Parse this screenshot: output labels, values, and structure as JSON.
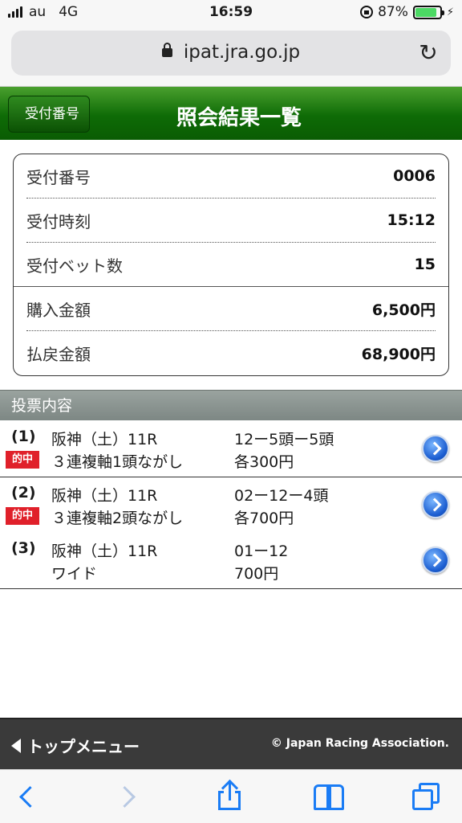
{
  "status_bar": {
    "carrier": "au",
    "network": "4G",
    "time": "16:59",
    "battery": "87%",
    "battery_level": 0.87
  },
  "browser": {
    "url": "ipat.jra.go.jp"
  },
  "header": {
    "back_label": "受付番号",
    "title": "照会結果一覧"
  },
  "info": {
    "rows": [
      {
        "label": "受付番号",
        "value": "0006"
      },
      {
        "label": "受付時刻",
        "value": "15:12"
      },
      {
        "label": "受付ベット数",
        "value": "15"
      },
      {
        "label": "購入金額",
        "value": "6,500円"
      },
      {
        "label": "払戻金額",
        "value": "68,900円"
      }
    ]
  },
  "section": {
    "title": "投票内容"
  },
  "tickets": [
    {
      "num": "(1)",
      "race": "阪神（土）11R",
      "combo": "12ー5頭ー5頭",
      "bet_type": "３連複軸1頭ながし",
      "amount": "各300円",
      "hit": "的中"
    },
    {
      "num": "(2)",
      "race": "阪神（土）11R",
      "combo": "02ー12ー4頭",
      "bet_type": "３連複軸2頭ながし",
      "amount": "各700円",
      "hit": "的中"
    },
    {
      "num": "(3)",
      "race": "阪神（土）11R",
      "combo": "01ー12",
      "bet_type": "ワイド",
      "amount": "700円"
    }
  ],
  "footer": {
    "top_menu": "トップメニュー",
    "copyright": "© Japan Racing Association."
  },
  "colors": {
    "header_green": "#0e6b06",
    "hit_red": "#e0202a",
    "ios_blue": "#1a7cf5"
  }
}
